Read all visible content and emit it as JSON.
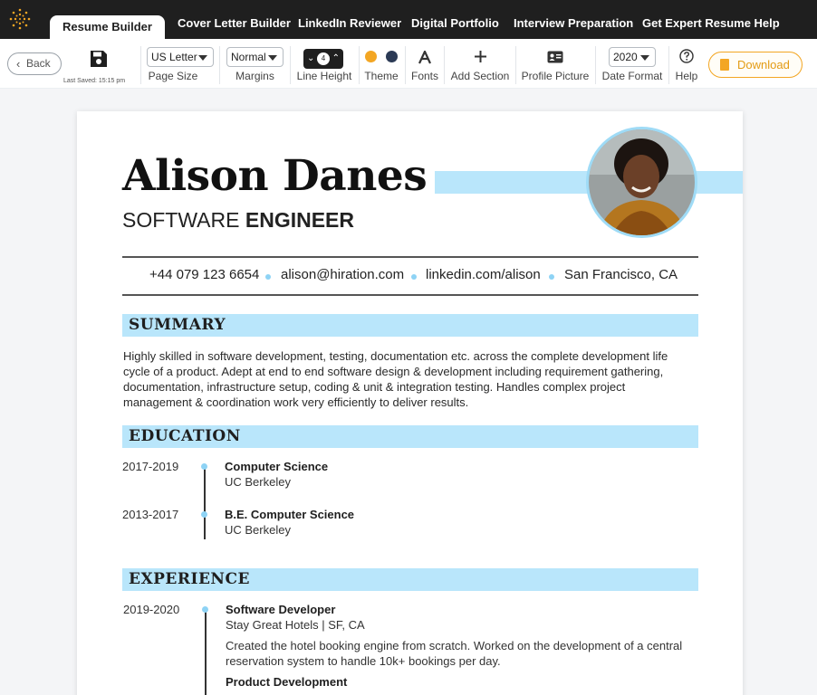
{
  "nav": {
    "tabs": [
      {
        "label": "Resume Builder"
      },
      {
        "label": "Cover Letter Builder"
      },
      {
        "label": "LinkedIn Reviewer"
      },
      {
        "label": "Digital Portfolio"
      },
      {
        "label": "Interview Preparation"
      },
      {
        "label": "Get Expert Resume Help"
      }
    ],
    "active_tab": "Resume Builder"
  },
  "toolbar": {
    "back_label": "Back",
    "last_saved": "Last Saved: 15:15 pm",
    "page_size": {
      "value": "US Letter",
      "label": "Page Size"
    },
    "margins": {
      "value": "Normal",
      "label": "Margins"
    },
    "line_height": {
      "value": "4",
      "label": "Line Height"
    },
    "theme": {
      "label": "Theme",
      "colors": [
        "#f3a623",
        "#2b3a55"
      ]
    },
    "fonts_label": "Fonts",
    "add_section_label": "Add Section",
    "profile_picture_label": "Profile Picture",
    "date_format": {
      "value": "2020",
      "label": "Date Format"
    },
    "help_label": "Help",
    "download_label": "Download"
  },
  "resume": {
    "name": "Alison Danes",
    "title_light": "SOFTWARE",
    "title_bold": "ENGINEER",
    "accent_color": "#b9e6fb",
    "contact": {
      "phone": "+44 079 123 6654",
      "email": "alison@hiration.com",
      "linkedin": "linkedin.com/alison",
      "location": "San Francisco, CA"
    },
    "summary": {
      "heading": "SUMMARY",
      "lines": [
        "Highly skilled in software development, testing, documentation etc. across the complete development life",
        "cycle of a product. Adept at end to end software design & development including requirement gathering,",
        "documentation, infrastructure setup, coding & unit & integration testing. Handles complex project",
        "management & coordination work very efficiently to deliver results."
      ]
    },
    "education": {
      "heading": "EDUCATION",
      "items": [
        {
          "date": "2017-2019",
          "degree": "Computer Science",
          "school": "UC Berkeley"
        },
        {
          "date": "2013-2017",
          "degree": "B.E. Computer Science",
          "school": "UC Berkeley"
        }
      ]
    },
    "experience": {
      "heading": "EXPERIENCE",
      "items": [
        {
          "date": "2019-2020",
          "role": "Software Developer",
          "company": "Stay Great Hotels |  SF, CA",
          "lines": [
            "Created the hotel booking engine from scratch. Worked on the development of a central",
            "reservation system to handle 10k+ bookings per day."
          ],
          "subheading": "Product Development"
        }
      ]
    }
  }
}
